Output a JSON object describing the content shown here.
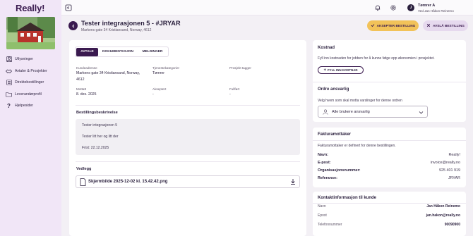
{
  "app": {
    "logo": "Really!"
  },
  "sidebar": {
    "items": [
      {
        "label": "Utlysninger",
        "icon": "user-icon"
      },
      {
        "label": "Avtaler & Prosjekter",
        "icon": "handshake-icon"
      },
      {
        "label": "Direktebestillinger",
        "icon": "list-icon"
      },
      {
        "label": "Leverandørprofil",
        "icon": "folder-icon"
      },
      {
        "label": "Hjelpesider",
        "icon": "help-icon"
      }
    ]
  },
  "topbar": {
    "user_initial": "J",
    "user_name": "Tømrer A",
    "user_sub": "Ved Jan Håkon Reinemo"
  },
  "header": {
    "title": "Tester integrasjonen 5 - #JRYAR",
    "subtitle": "Markens gate 34 Kristiansand, Norway, 4612",
    "accept_label": "AKSEPTER BESTILLING",
    "decline_label": "AVSLÅ BESTILLING"
  },
  "tabs": [
    {
      "label": "AVTALE",
      "active": true
    },
    {
      "label": "DOKUMENTASJON",
      "active": false
    },
    {
      "label": "MELDINGER",
      "active": false
    }
  ],
  "details": {
    "customer_address_label": "Kundeadresse",
    "customer_address_line1": "Markens gate 34 Kristiansand, Norway,",
    "customer_address_line2": "4612",
    "service_categories_label": "Tjenestekategorier",
    "service_categories_value": "Tømrer",
    "project_tags_label": "Prosjekt tagger",
    "received_label": "Mottatt",
    "received_value": "8. des. 2025",
    "accepted_label": "Akseptert",
    "accepted_value": "-",
    "completed_label": "Fullført",
    "completed_value": "-"
  },
  "description": {
    "title": "Bestillingsbeskrivelse",
    "lines": [
      "Tester integrasjonen 5",
      "Tester litt her og litt der",
      "Frist: 22.12.2025"
    ]
  },
  "attachments": {
    "title": "Vedlegg",
    "file_name": "Skjermbilde 2025-12-02 kl. 15.42.42.png"
  },
  "cost": {
    "title": "Kostnad",
    "text": "Fyll inn kostnaden for jobben for å kunne følge opp økonomien i prosjektet.",
    "button": "FYLL INN KOSTNAD"
  },
  "responsible": {
    "title": "Ordre ansvarlig",
    "text": "Velg hvem som skal motta varslinger for denne ordren",
    "select_value": "Alle brukere ansvarlig"
  },
  "invoice": {
    "title": "Fakturamottaker",
    "text": "Fakturamottaker er definert for denne bestillingen.",
    "rows": [
      {
        "key": "Navn:",
        "value": "Really!"
      },
      {
        "key": "E-post:",
        "value": "invoice@really.no"
      },
      {
        "key": "Organisasjonsnummer:",
        "value": "925 401 919"
      },
      {
        "key": "Referanse:",
        "value": "JRYAR"
      }
    ]
  },
  "contact": {
    "title": "Kontaktinformasjon til kunde",
    "rows": [
      {
        "key": "Navn",
        "value": "Jan Håkon Reinemo"
      },
      {
        "key": "Epost",
        "value": "jan.hakon@really.no"
      },
      {
        "key": "Telefonnummer",
        "value": "90090900"
      }
    ]
  },
  "colors": {
    "primary": "#3a1a4f",
    "accent": "#f2c259",
    "sidebar_bg": "#f1e6f7"
  }
}
